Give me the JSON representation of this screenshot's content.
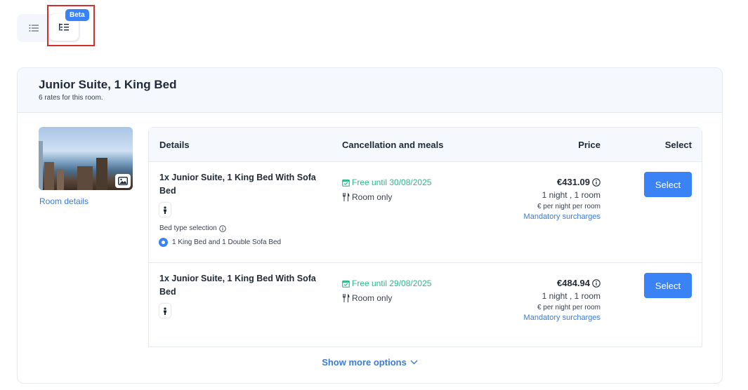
{
  "view_toggle": {
    "list_icon": "list-icon",
    "tree_icon": "tree-list-icon",
    "beta_label": "Beta"
  },
  "room": {
    "title": "Junior Suite, 1 King Bed",
    "subtitle": "6 rates for this room.",
    "details_link": "Room details",
    "photo_icon": "gallery-icon"
  },
  "table": {
    "headers": {
      "details": "Details",
      "cancellation": "Cancellation and meals",
      "price": "Price",
      "select": "Select"
    },
    "rates": [
      {
        "name": "1x Junior Suite, 1 King Bed With Sofa Bed",
        "bed_type_label": "Bed type selection",
        "bed_option": "1 King Bed and 1 Double Sofa Bed",
        "cancellation": "Free until 30/08/2025",
        "meal": "Room only",
        "price": "€431.09",
        "nights": "1 night , 1 room",
        "per_night": "€ per night per room",
        "surcharges": "Mandatory surcharges",
        "select_label": "Select"
      },
      {
        "name": "1x Junior Suite, 1 King Bed With Sofa Bed",
        "cancellation": "Free until 29/08/2025",
        "meal": "Room only",
        "price": "€484.94",
        "nights": "1 night , 1 room",
        "per_night": "€ per night per room",
        "surcharges": "Mandatory surcharges",
        "select_label": "Select"
      }
    ]
  },
  "show_more": "Show more options",
  "colors": {
    "accent": "#3b82f6",
    "link": "#3b7bd6",
    "free_cancel": "#2fb88a",
    "highlight": "#d32f2f"
  }
}
